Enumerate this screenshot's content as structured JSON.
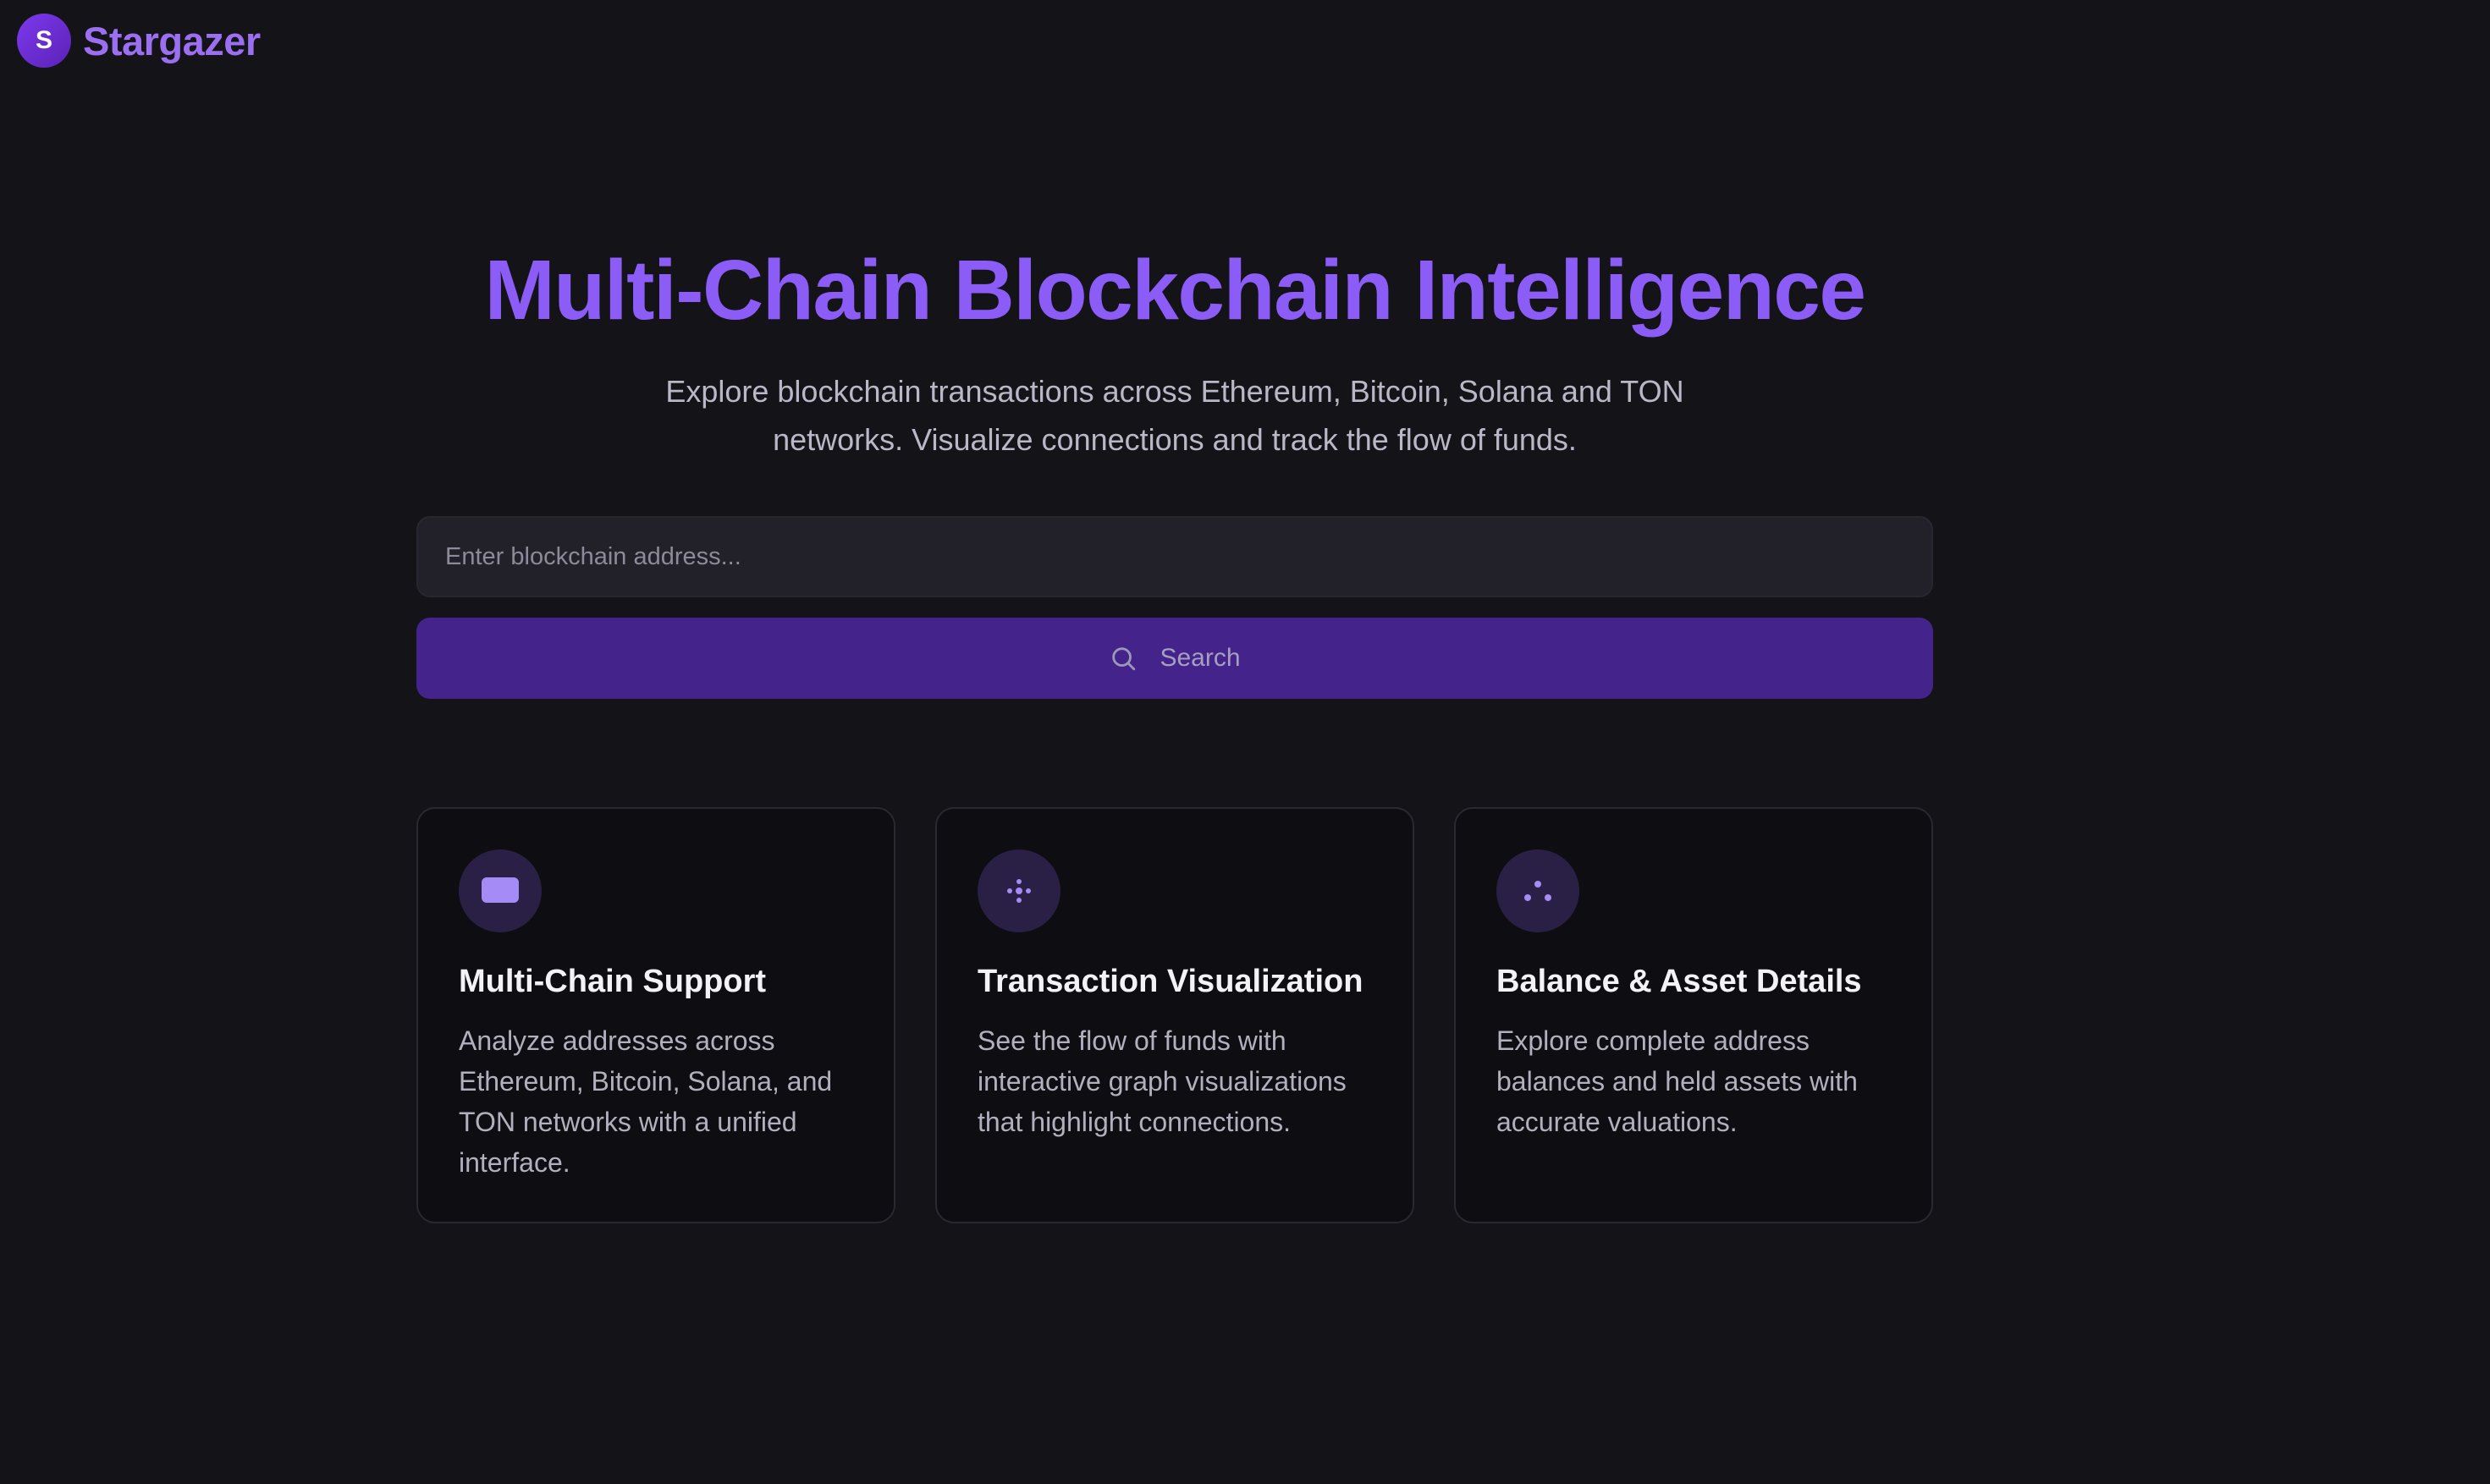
{
  "brand": {
    "logo_letter": "S",
    "name": "Stargazer"
  },
  "hero": {
    "title": "Multi-Chain Blockchain Intelligence",
    "subtitle": "Explore blockchain transactions across Ethereum, Bitcoin, Solana and TON networks. Visualize connections and track the flow of funds."
  },
  "search": {
    "placeholder": "Enter blockchain address...",
    "value": "",
    "button_label": "Search",
    "icon": "search-icon"
  },
  "features": [
    {
      "icon": "wallet-icon",
      "title": "Multi-Chain Support",
      "description": "Analyze addresses across Ethereum, Bitcoin, Solana, and TON networks with a unified interface."
    },
    {
      "icon": "network-icon",
      "title": "Transaction Visualization",
      "description": "See the flow of funds with interactive graph visualizations that highlight connections."
    },
    {
      "icon": "nodes-icon",
      "title": "Balance & Asset Details",
      "description": "Explore complete address balances and held assets with accurate valuations."
    }
  ],
  "colors": {
    "background": "#141318",
    "accent": "#8b5cf6",
    "button": "#44238a",
    "card_background": "#0e0d11",
    "icon_background": "#2a1f45"
  }
}
